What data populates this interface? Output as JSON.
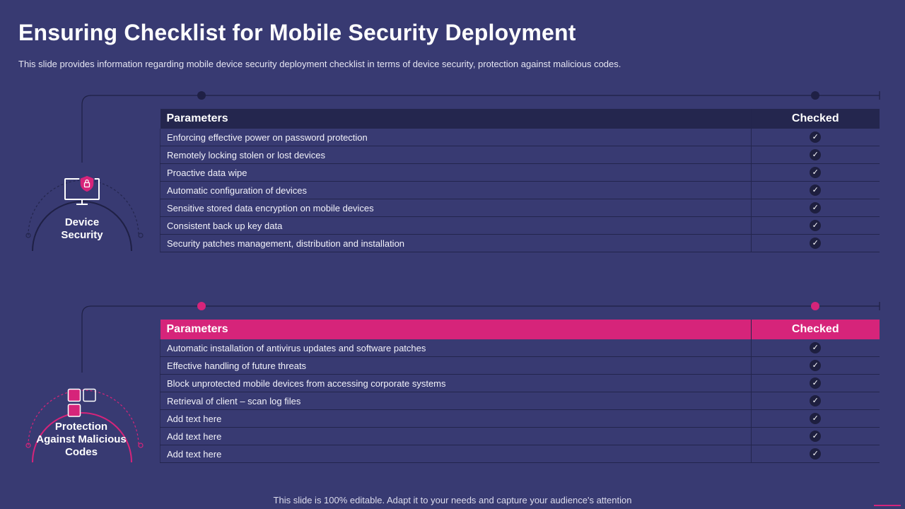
{
  "slide": {
    "title": "Ensuring Checklist for Mobile Security Deployment",
    "subtitle": "This slide provides information regarding mobile device security deployment checklist in terms of device security, protection against malicious codes.",
    "footer": "This slide is 100% editable. Adapt it to your needs and capture your audience's attention"
  },
  "colors": {
    "background": "#383a72",
    "dark_header": "#24264e",
    "accent_pink": "#d6247a",
    "check_badge": "#1e1f3f"
  },
  "sections": [
    {
      "label_lines": [
        "Device",
        "Security"
      ],
      "icon": "monitor-shield-lock-icon",
      "header": {
        "parameters": "Parameters",
        "checked": "Checked"
      },
      "rows": [
        "Enforcing effective power on password protection",
        "Remotely locking stolen or lost devices",
        "Proactive data wipe",
        "Automatic configuration of devices",
        "Sensitive stored data encryption on mobile devices",
        "Consistent back up key data",
        "Security patches management, distribution and installation"
      ]
    },
    {
      "label_lines": [
        "Protection",
        "Against Malicious",
        "Codes"
      ],
      "icon": "squares-grid-icon",
      "header": {
        "parameters": "Parameters",
        "checked": "Checked"
      },
      "rows": [
        "Automatic installation of antivirus updates and software patches",
        "Effective handling of future threats",
        "Block unprotected mobile devices from accessing corporate systems",
        "Retrieval  of client – scan log files",
        "Add text here",
        "Add text here",
        "Add text here"
      ]
    }
  ],
  "check_glyph": "✓"
}
